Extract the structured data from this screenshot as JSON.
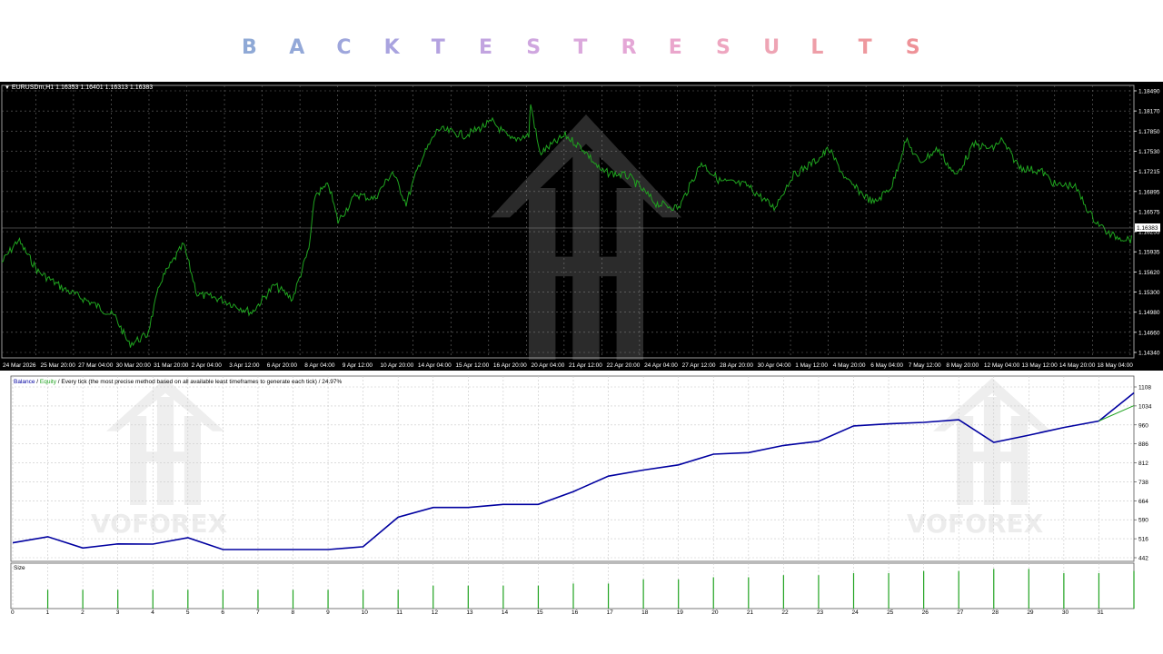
{
  "banner": {
    "letters": [
      "B",
      "A",
      "C",
      "K",
      "T",
      "E",
      "S",
      "T",
      "R",
      "E",
      "S",
      "U",
      "L",
      "T",
      "S"
    ],
    "colors": [
      "#8fa9d6",
      "#93a8d8",
      "#9ea6dc",
      "#a9a3df",
      "#b4a2e0",
      "#c2a4e0",
      "#cfa6df",
      "#dba8dc",
      "#e4a7d6",
      "#eaa6cc",
      "#eea6c0",
      "#eea4b4",
      "#ee9ea8",
      "#ee989e",
      "#ee9298"
    ]
  },
  "price_chart": {
    "symbol_info": "EURUSDm,H1  1.16353 1.16401 1.16313 1.16383",
    "current_price": "1.16383",
    "y_ticks": [
      "1.18490",
      "1.18170",
      "1.17850",
      "1.17530",
      "1.17215",
      "1.16895",
      "1.16575",
      "1.16255",
      "1.15935",
      "1.15620",
      "1.15300",
      "1.14980",
      "1.14660",
      "1.14340"
    ],
    "x_ticks": [
      "24 Mar 2026",
      "25 Mar 20:00",
      "27 Mar 04:00",
      "30 Mar 20:00",
      "31 Mar 20:00",
      "2 Apr 04:00",
      "3 Apr 12:00",
      "6 Apr 20:00",
      "8 Apr 04:00",
      "9 Apr 12:00",
      "10 Apr 20:00",
      "14 Apr 04:00",
      "15 Apr 12:00",
      "16 Apr 20:00",
      "20 Apr 04:00",
      "21 Apr 12:00",
      "22 Apr 20:00",
      "24 Apr 04:00",
      "27 Apr 12:00",
      "28 Apr 20:00",
      "30 Apr 04:00",
      "1 May 12:00",
      "4 May 20:00",
      "6 May 04:00",
      "7 May 12:00",
      "8 May 20:00",
      "12 May 04:00",
      "13 May 12:00",
      "14 May 20:00",
      "18 May 04:00"
    ],
    "colors": {
      "background": "#000000",
      "grid": "#6b6b6b",
      "line": "#1fa31f",
      "axis_text": "#ffffff"
    },
    "watermark_icon": "house-logo-icon"
  },
  "tester": {
    "graph_header": {
      "balance": "Balance",
      "sep": " / ",
      "equity": "Equity",
      "rest": " / Every tick (the most precise method based on all available least timeframes to generate each tick) / 24.97%"
    },
    "size_label": "Size",
    "colors": {
      "balance": "#0000a0",
      "equity": "#1fa31f",
      "grid": "#c8c8c8",
      "size_bar": "#1fa31f"
    },
    "watermark_icon": "house-logo-icon",
    "watermark_text": "VOFOREX"
  },
  "chart_data": {
    "type": "line",
    "series": [
      {
        "name": "Balance",
        "x": [
          0,
          1,
          2,
          3,
          4,
          5,
          6,
          7,
          8,
          9,
          10,
          11,
          12,
          13,
          14,
          15,
          16,
          17,
          18,
          19,
          20,
          21,
          22,
          23,
          24,
          25,
          26,
          27,
          28,
          29,
          30,
          31,
          32
        ],
        "values": [
          500,
          524,
          480,
          496,
          495,
          520,
          474,
          474,
          474,
          474,
          485,
          600,
          638,
          638,
          650,
          650,
          700,
          760,
          784,
          804,
          846,
          852,
          880,
          896,
          956,
          964,
          970,
          980,
          892,
          920,
          950,
          975,
          1085
        ]
      },
      {
        "name": "Equity",
        "x": [
          31,
          32
        ],
        "values": [
          975,
          1035
        ]
      }
    ],
    "y_ticks": [
      1108,
      1034,
      960,
      886,
      812,
      738,
      664,
      590,
      516,
      442
    ],
    "ylim": [
      442,
      1108
    ],
    "x_ticks": [
      "0",
      "1",
      "2",
      "3",
      "4",
      "5",
      "6",
      "7",
      "8",
      "9",
      "10",
      "11",
      "12",
      "13",
      "14",
      "15",
      "16",
      "17",
      "18",
      "19",
      "20",
      "21",
      "22",
      "23",
      "24",
      "25",
      "26",
      "27",
      "28",
      "29",
      "30",
      "31"
    ],
    "size_bars": [
      0.45,
      0.45,
      0.45,
      0.45,
      0.45,
      0.45,
      0.45,
      0.45,
      0.45,
      0.45,
      0.45,
      0.55,
      0.55,
      0.55,
      0.55,
      0.6,
      0.6,
      0.7,
      0.7,
      0.75,
      0.75,
      0.8,
      0.8,
      0.85,
      0.85,
      0.9,
      0.9,
      0.95,
      0.95,
      0.85,
      0.85,
      0.9,
      0.95
    ],
    "grid": true
  }
}
